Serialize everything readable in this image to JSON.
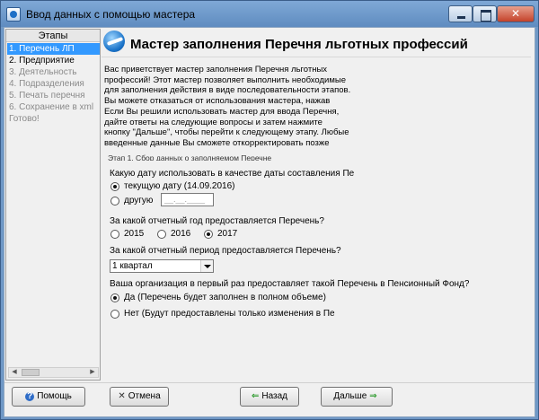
{
  "window": {
    "title": "Ввод данных с помощью мастера"
  },
  "sidebar": {
    "header": "Этапы",
    "steps": [
      "1. Перечень ЛП",
      "2. Предприятие",
      "3. Деятельность",
      "4. Подразделения",
      "5. Печать перечня",
      "6. Сохранение в xml",
      "Готово!"
    ]
  },
  "wizard": {
    "title": "Мастер заполнения Перечня льготных профессий",
    "intro_lines": [
      "Вас приветствует мастер заполнения Перечня льготных",
      "профессий! Этот мастер позволяет выполнить необходимые",
      "для заполнения действия в виде последовательности этапов.",
      "Вы можете отказаться от использования мастера, нажав",
      "Если Вы решили использовать мастер для ввода Перечня,",
      "дайте ответы на следующие вопросы и затем нажмите",
      "кнопку \"Дальше\", чтобы перейти к следующему этапу. Любые",
      "введенные данные Вы сможете откорректировать позже"
    ],
    "stage_label": "Этап 1. Сбор данных о заполняемом Перечне"
  },
  "form": {
    "q_date": "Какую дату использовать в качестве даты составления Пе",
    "date_current_label": "текущую дату (14.09.2016)",
    "date_other_label": "другую",
    "date_other_placeholder": "__.__.____",
    "q_year": "За какой отчетный год предоставляется Перечень?",
    "years": [
      "2015",
      "2016",
      "2017"
    ],
    "selected_year": "2017",
    "q_period": "За какой отчетный период предоставляется Перечень?",
    "period_value": "1 квартал",
    "q_first": "Ваша организация в первый раз предоставляет такой Перечень в Пенсионный Фонд?",
    "first_yes_label": "Да (Перечень будет заполнен в полном объеме)",
    "first_no_label": "Нет (Будут предоставлены только изменения в Пе"
  },
  "buttons": {
    "help": "Помощь",
    "cancel": "Отмена",
    "back": "Назад",
    "next": "Дальше"
  },
  "icons": {
    "help": "question-circle-icon",
    "cancel": "x-icon",
    "back": "arrow-left-icon",
    "next": "arrow-right-icon"
  }
}
